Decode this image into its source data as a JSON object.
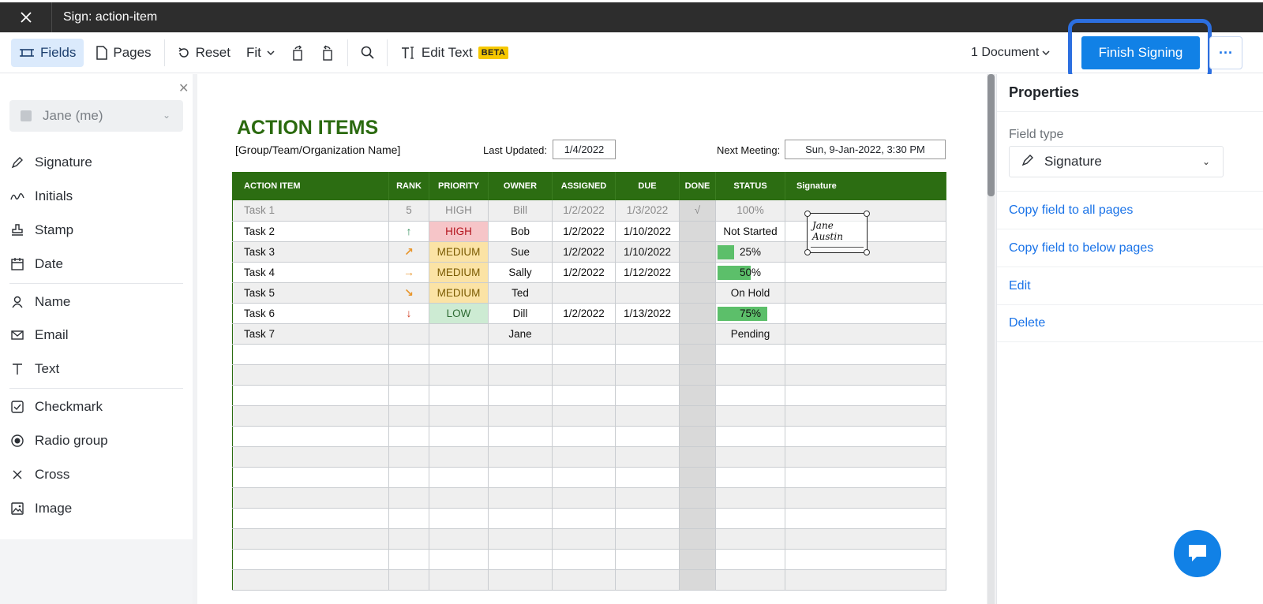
{
  "window": {
    "title": "Sign: action-item"
  },
  "toolbar": {
    "fields": "Fields",
    "pages": "Pages",
    "reset": "Reset",
    "fit": "Fit",
    "edit_text": "Edit Text",
    "beta": "BETA",
    "documents": "1 Document",
    "finish": "Finish Signing",
    "more": "···"
  },
  "left_panel": {
    "signer": "Jane (me)",
    "fields": [
      {
        "label": "Signature",
        "icon": "pen-icon"
      },
      {
        "label": "Initials",
        "icon": "initials-icon"
      },
      {
        "label": "Stamp",
        "icon": "stamp-icon"
      },
      {
        "label": "Date",
        "icon": "calendar-icon"
      },
      {
        "label": "Name",
        "icon": "person-icon"
      },
      {
        "label": "Email",
        "icon": "mail-icon"
      },
      {
        "label": "Text",
        "icon": "text-icon"
      },
      {
        "label": "Checkmark",
        "icon": "checkbox-icon"
      },
      {
        "label": "Radio group",
        "icon": "radio-icon"
      },
      {
        "label": "Cross",
        "icon": "cross-icon"
      },
      {
        "label": "Image",
        "icon": "image-icon"
      }
    ]
  },
  "document": {
    "title": "ACTION ITEMS",
    "subtitle": "[Group/Team/Organization Name]",
    "last_updated_label": "Last Updated:",
    "last_updated": "1/4/2022",
    "next_meeting_label": "Next Meeting:",
    "next_meeting": "Sun, 9-Jan-2022, 3:30 PM",
    "columns": [
      "ACTION ITEM",
      "RANK",
      "PRIORITY",
      "OWNER",
      "ASSIGNED",
      "DUE",
      "DONE",
      "STATUS",
      "Signature"
    ],
    "rows": [
      {
        "item": "Task 1",
        "rank": "5",
        "priority": "HIGH",
        "owner": "Bill",
        "assigned": "1/2/2022",
        "due": "1/3/2022",
        "done": "√",
        "status": "100%",
        "progress": 1.0
      },
      {
        "item": "Task 2",
        "rank": "↑",
        "priority": "HIGH",
        "owner": "Bob",
        "assigned": "1/2/2022",
        "due": "1/10/2022",
        "done": "",
        "status": "Not Started",
        "progress": 0
      },
      {
        "item": "Task 3",
        "rank": "↗",
        "priority": "MEDIUM",
        "owner": "Sue",
        "assigned": "1/2/2022",
        "due": "1/10/2022",
        "done": "",
        "status": "25%",
        "progress": 0.25
      },
      {
        "item": "Task 4",
        "rank": "→",
        "priority": "MEDIUM",
        "owner": "Sally",
        "assigned": "1/2/2022",
        "due": "1/12/2022",
        "done": "",
        "status": "50%",
        "progress": 0.5
      },
      {
        "item": "Task 5",
        "rank": "↘",
        "priority": "MEDIUM",
        "owner": "Ted",
        "assigned": "",
        "due": "",
        "done": "",
        "status": "On Hold",
        "progress": 0
      },
      {
        "item": "Task 6",
        "rank": "↓",
        "priority": "LOW",
        "owner": "Dill",
        "assigned": "1/2/2022",
        "due": "1/13/2022",
        "done": "",
        "status": "75%",
        "progress": 0.75
      },
      {
        "item": "Task 7",
        "rank": "",
        "priority": "",
        "owner": "Jane",
        "assigned": "",
        "due": "",
        "done": "",
        "status": "Pending",
        "progress": 0
      }
    ],
    "signature_text": "Jane Austin"
  },
  "right_panel": {
    "title": "Properties",
    "field_type_label": "Field type",
    "field_type": "Signature",
    "links": [
      "Copy field to all pages",
      "Copy field to below pages",
      "Edit",
      "Delete"
    ]
  },
  "colors": {
    "accent": "#1181e6",
    "header_green": "#2c6d12",
    "title_green": "#2b6a0f",
    "progress_green": "#5cbf6a",
    "high": "#f6c5c8",
    "medium": "#fbe3a5",
    "low": "#cdebd3",
    "rank_up": "#2e8b57",
    "rank_mid": "#e8952a",
    "rank_down": "#d23a1f"
  }
}
